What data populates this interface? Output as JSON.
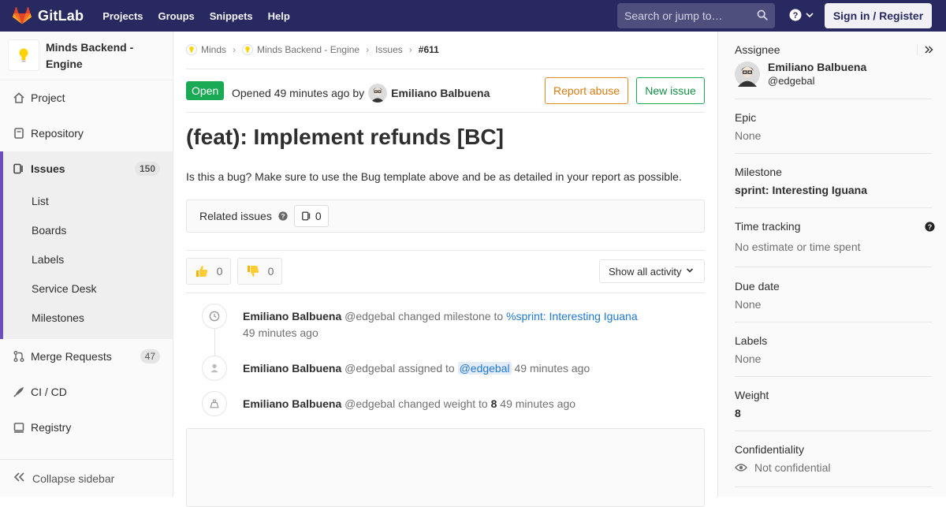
{
  "topbar": {
    "brand": "GitLab",
    "nav": [
      "Projects",
      "Groups",
      "Snippets",
      "Help"
    ],
    "search_placeholder": "Search or jump to…",
    "signin": "Sign in / Register"
  },
  "sidebar": {
    "project_name": "Minds Backend - Engine",
    "items": [
      {
        "label": "Project",
        "icon": "home-icon"
      },
      {
        "label": "Repository",
        "icon": "doc-icon"
      },
      {
        "label": "Issues",
        "icon": "issues-icon",
        "badge": "150"
      },
      {
        "label": "Merge Requests",
        "icon": "merge-request-icon",
        "badge": "47"
      },
      {
        "label": "CI / CD",
        "icon": "rocket-icon"
      },
      {
        "label": "Registry",
        "icon": "container-icon"
      }
    ],
    "issue_subitems": [
      "List",
      "Boards",
      "Labels",
      "Service Desk",
      "Milestones"
    ],
    "collapse_label": "Collapse sidebar"
  },
  "breadcrumb": {
    "items": [
      "Minds",
      "Minds Backend - Engine",
      "Issues"
    ],
    "current": "#611"
  },
  "issue": {
    "status": "Open",
    "opened_text": "Opened 49 minutes ago by",
    "author": "Emiliano Balbuena",
    "report_abuse": "Report abuse",
    "new_issue": "New issue",
    "title": "(feat): Implement refunds [BC]",
    "description": "Is this a bug? Make sure to use the Bug template above and be as detailed in your report as possible.",
    "related_label": "Related issues",
    "related_count": "0",
    "thumbs_up": "0",
    "thumbs_down": "0",
    "activity_filter": "Show all activity"
  },
  "timeline": [
    {
      "author": "Emiliano Balbuena",
      "handle": "@edgebal",
      "action": "changed milestone to",
      "link": "%sprint: Interesting Iguana",
      "time": "49 minutes ago"
    },
    {
      "author": "Emiliano Balbuena",
      "handle": "@edgebal",
      "action": "assigned to",
      "mention": "@edgebal",
      "time": "49 minutes ago"
    },
    {
      "author": "Emiliano Balbuena",
      "handle": "@edgebal",
      "action": "changed weight to",
      "value": "8",
      "time": "49 minutes ago"
    }
  ],
  "right_sidebar": {
    "assignee_title": "Assignee",
    "assignee_name": "Emiliano Balbuena",
    "assignee_handle": "@edgebal",
    "epic_title": "Epic",
    "epic_value": "None",
    "milestone_title": "Milestone",
    "milestone_value": "sprint: Interesting Iguana",
    "time_title": "Time tracking",
    "time_value": "No estimate or time spent",
    "due_title": "Due date",
    "due_value": "None",
    "labels_title": "Labels",
    "labels_value": "None",
    "weight_title": "Weight",
    "weight_value": "8",
    "conf_title": "Confidentiality",
    "conf_value": "Not confidential"
  },
  "colors": {
    "nav_bg": "#292961",
    "open_green": "#1aaa55",
    "abuse_orange": "#e08c26",
    "link_blue": "#1f78d1",
    "active_border": "#6b4fbb"
  }
}
